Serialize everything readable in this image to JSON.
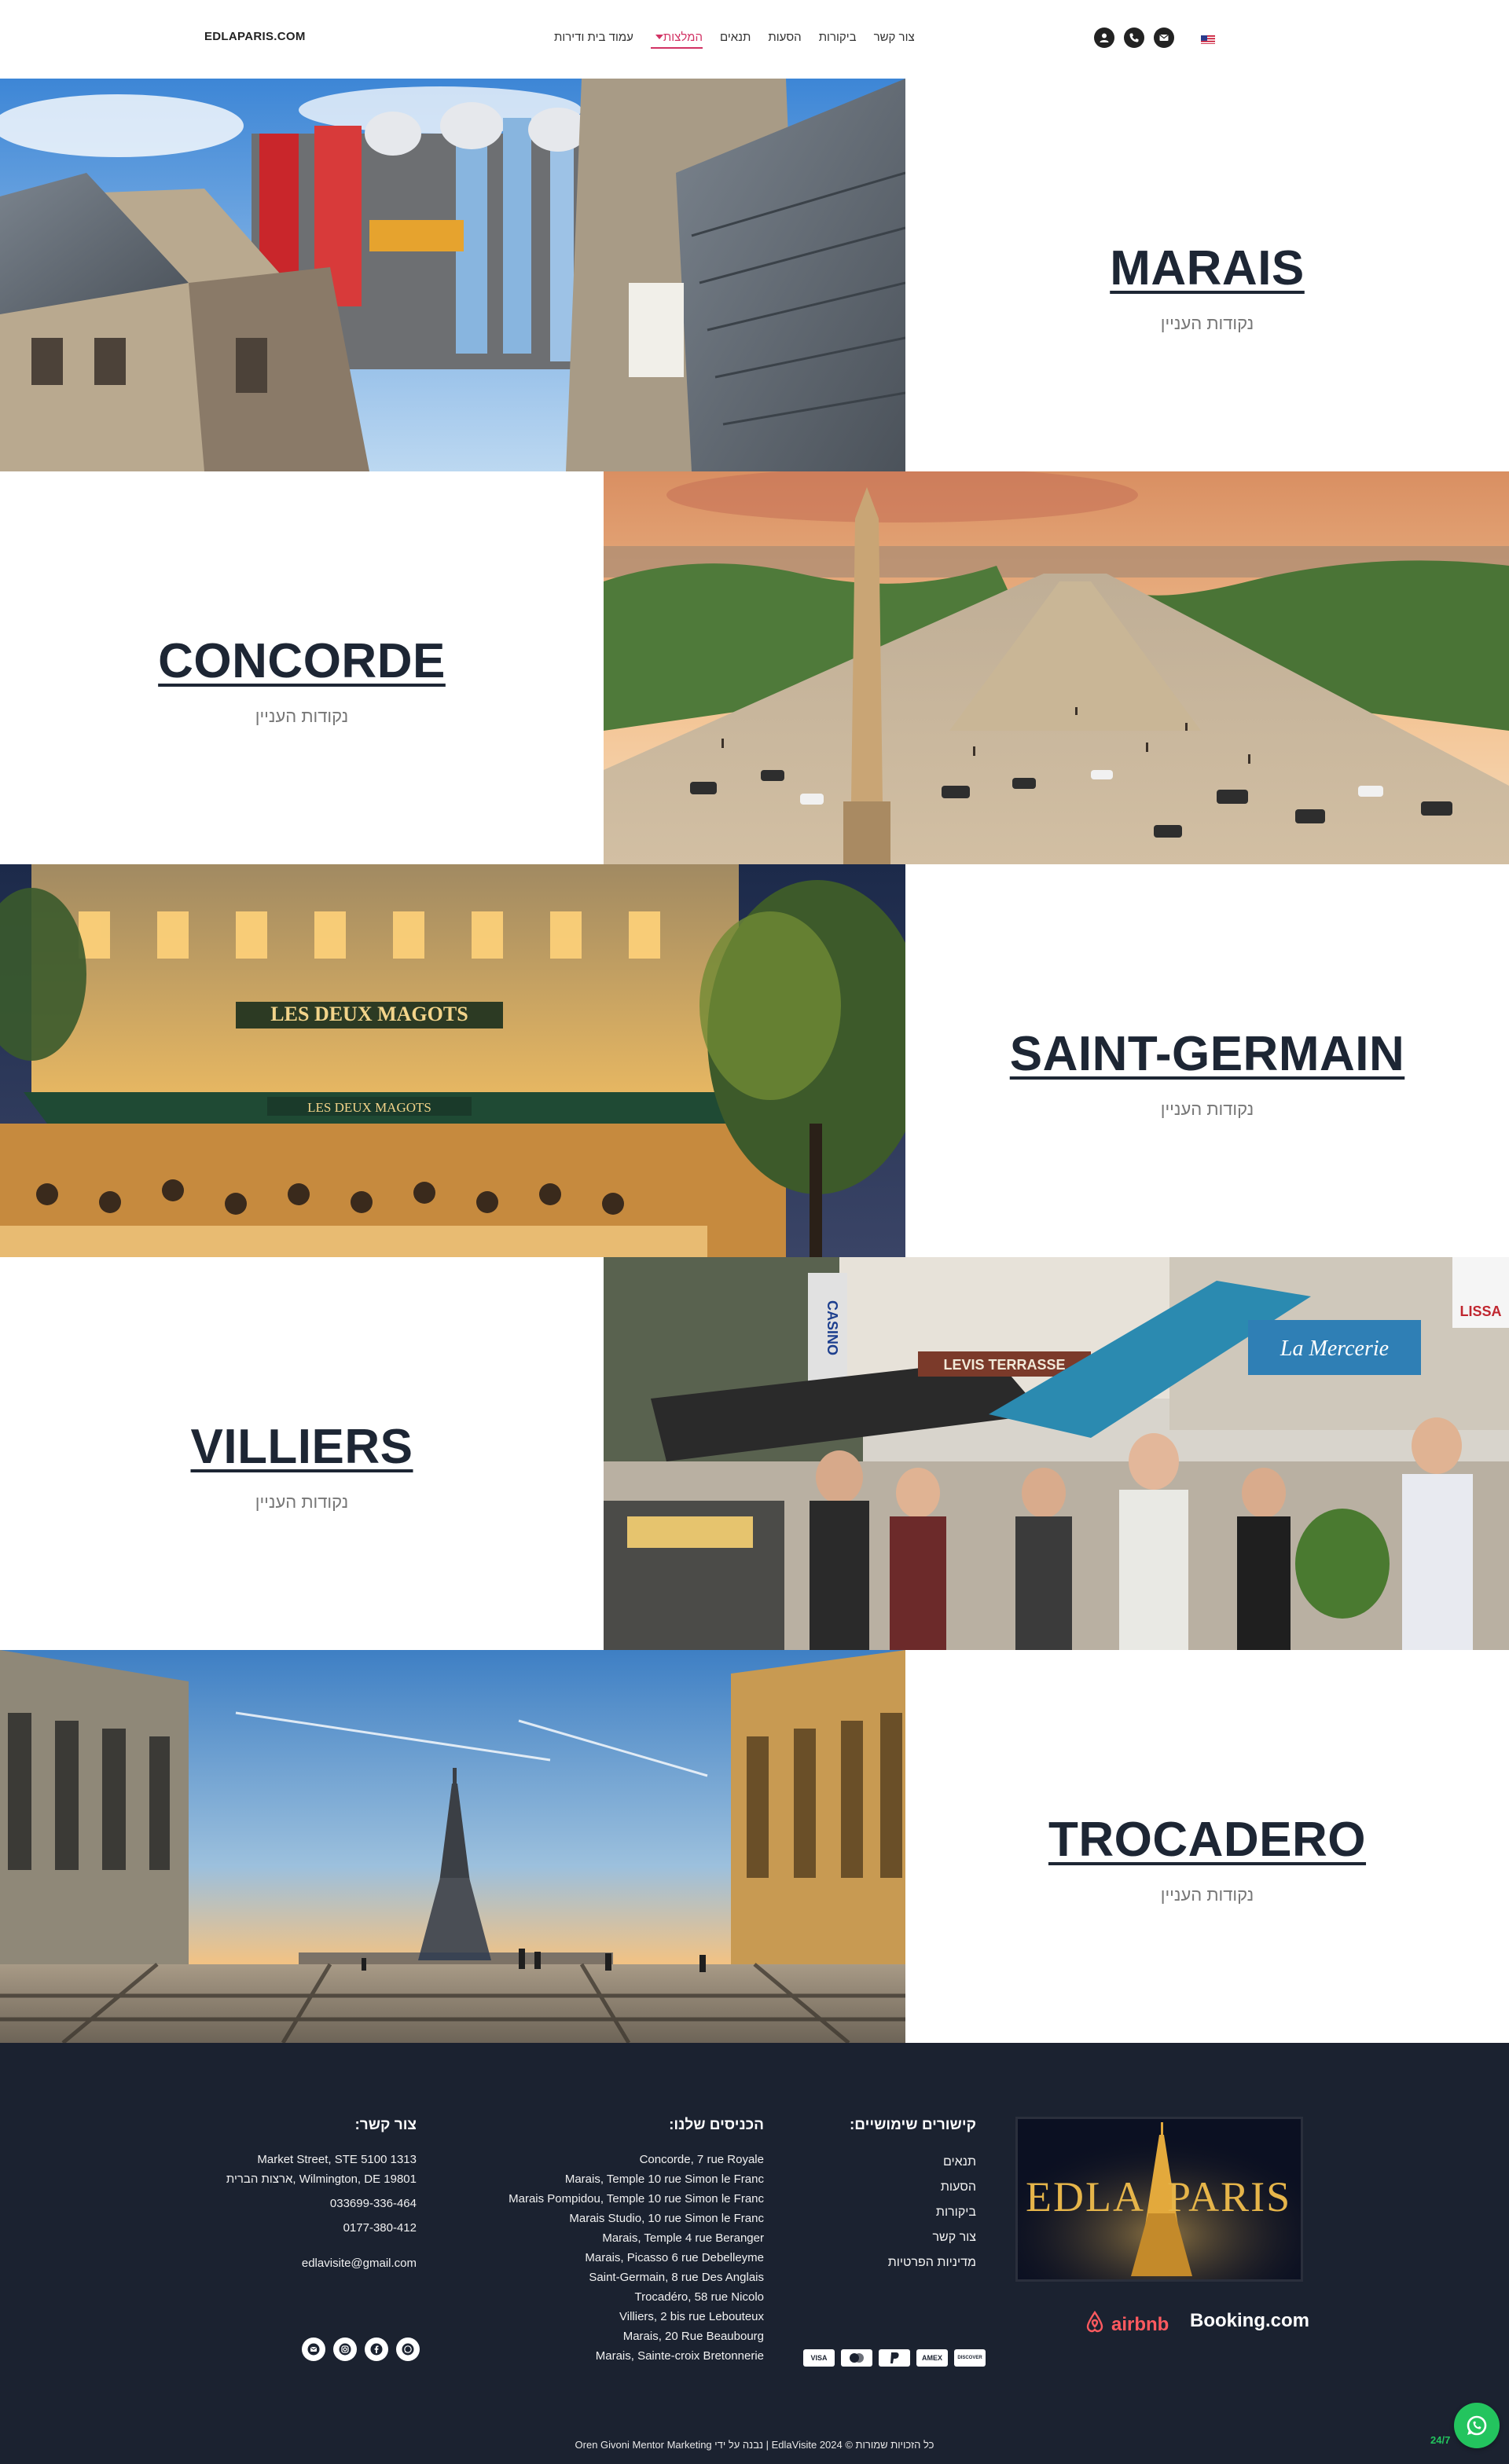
{
  "header": {
    "brand": "EDLAPARIS.COM",
    "nav": [
      {
        "label": "עמוד בית ודירות"
      },
      {
        "label": "המלצות"
      },
      {
        "label": "תנאים"
      },
      {
        "label": "הסעות"
      },
      {
        "label": "ביקורות"
      },
      {
        "label": "צור קשר"
      }
    ],
    "active_nav": "המלצות",
    "icons": [
      "user-icon",
      "phone-icon",
      "email-icon"
    ],
    "language_flag": "us-flag-icon"
  },
  "areas": [
    {
      "title": "MARAIS",
      "subtitle": "נקודות העניין"
    },
    {
      "title": "CONCORDE",
      "subtitle": "נקודות העניין"
    },
    {
      "title": "SAINT-GERMAIN",
      "subtitle": "נקודות העניין"
    },
    {
      "title": "VILLIERS",
      "subtitle": "נקודות העניין"
    },
    {
      "title": "TROCADERO",
      "subtitle": "נקודות העניין"
    }
  ],
  "photos": {
    "concorde_sign": "",
    "saint_germain_sign": "LES DEUX MAGOTS",
    "saint_germain_sign_2": "LES DEUX MAGOTS",
    "villiers_sign_1": "LEVIS TERRASSE",
    "villiers_sign_2": "La Mercerie",
    "villiers_sign_3": "LISSA",
    "villiers_sign_4": "CASINO"
  },
  "footer": {
    "links_heading": "קישורים שימושיים:",
    "links": [
      "תנאים",
      "הסעות",
      "ביקורות",
      "צור קשר",
      "מדיניות הפרטיות"
    ],
    "entrances_heading": "הכניסים שלנו:",
    "entrances": [
      "Concorde, 7 rue Royale",
      "Marais, Temple 10 rue Simon le Franc",
      "Marais Pompidou, Temple 10 rue Simon le Franc",
      "Marais Studio, 10 rue Simon le Franc",
      "Marais, Temple 4 rue Beranger",
      "Marais, Picasso 6 rue Debelleyme",
      "Saint-Germain, 8 rue Des Anglais",
      "Trocadéro, 58 rue Nicolo",
      "Villiers, 2 bis rue Lebouteux",
      "Marais, 20 Rue Beaubourg",
      "Marais, Sainte-croix Bretonnerie"
    ],
    "contact_heading": "צור קשר:",
    "address_line1": "Market Street, STE 5100 1313",
    "address_line2": "Wilmington, DE 19801 ,ארצות הברית",
    "phone1": "033699-336-464",
    "phone2": "0177-380-412",
    "email": "edlavisite@gmail.com",
    "logo_left": "EDLA",
    "logo_right": "PARIS",
    "partners": [
      "airbnb",
      "Booking.com"
    ],
    "payment_cards": [
      "VISA",
      "MC",
      "PayPal",
      "AMEX",
      "DISCOVER"
    ],
    "social": [
      "email-icon",
      "instagram-icon",
      "facebook-icon",
      "whatsapp-icon"
    ],
    "copyright": "כל הזכויות שמורות © EdlaVisite 2024 | נבנה על ידי Oren Givoni Mentor Marketing"
  },
  "floating": {
    "whatsapp_label": "24/7"
  },
  "colors": {
    "accent": "#d23264",
    "footer_bg": "#1b2230",
    "title": "#1d2634",
    "whatsapp": "#23c45e"
  }
}
